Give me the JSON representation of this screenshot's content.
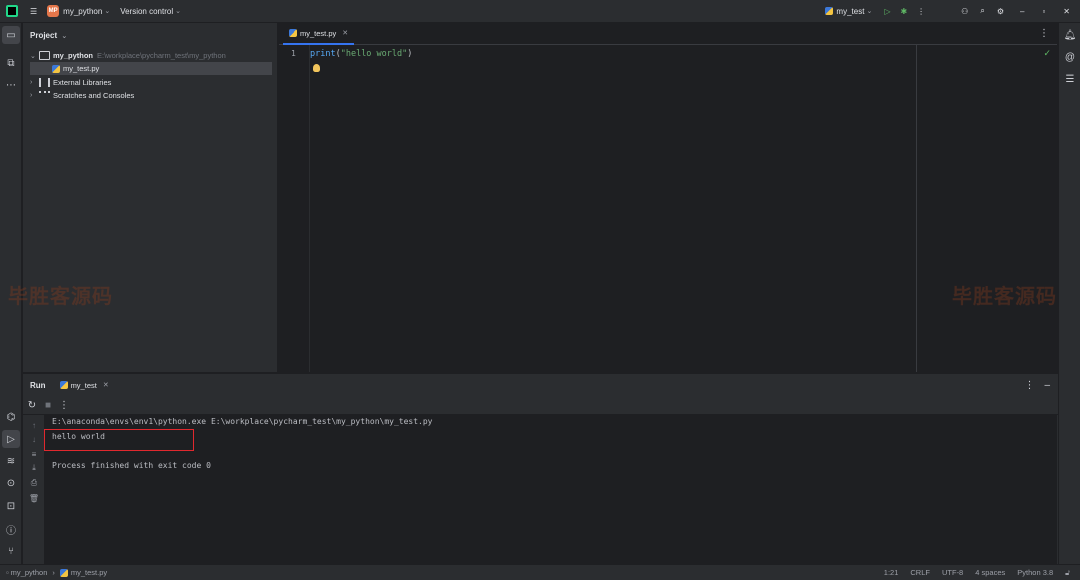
{
  "titlebar": {
    "project_badge": "MP",
    "project_name": "my_python",
    "vcs_label": "Version control",
    "run_config": "my_test"
  },
  "project_panel": {
    "title": "Project",
    "tree": [
      {
        "label": "my_python",
        "path": "E:\\workplace\\pycharm_test\\my_python",
        "type": "folder",
        "expanded": true
      },
      {
        "label": "my_test.py",
        "type": "python-file",
        "selected": true
      },
      {
        "label": "External Libraries",
        "type": "library"
      },
      {
        "label": "Scratches and Consoles",
        "type": "scratches"
      }
    ]
  },
  "editor": {
    "tab_label": "my_test.py",
    "lines": [
      {
        "number": "1",
        "fn": "print",
        "open": "(",
        "str": "\"hello world\"",
        "close": ")"
      }
    ]
  },
  "run_panel": {
    "title": "Run",
    "tab_label": "my_test",
    "console": [
      "E:\\anaconda\\envs\\env1\\python.exe E:\\workplace\\pycharm_test\\my_python\\my_test.py",
      "hello world",
      "",
      "Process finished with exit code 0"
    ]
  },
  "statusbar": {
    "breadcrumb_project": "my_python",
    "breadcrumb_file": "my_test.py",
    "position": "1:21",
    "line_ending": "CRLF",
    "encoding": "UTF-8",
    "indent": "4 spaces",
    "interpreter": "Python 3.8"
  },
  "watermark": {
    "text_left": "毕胜客源码",
    "text_right": "毕胜客源码"
  },
  "colors": {
    "accent": "#3574f0",
    "highlight_box": "#e0282e",
    "run_green": "#5fb865"
  }
}
